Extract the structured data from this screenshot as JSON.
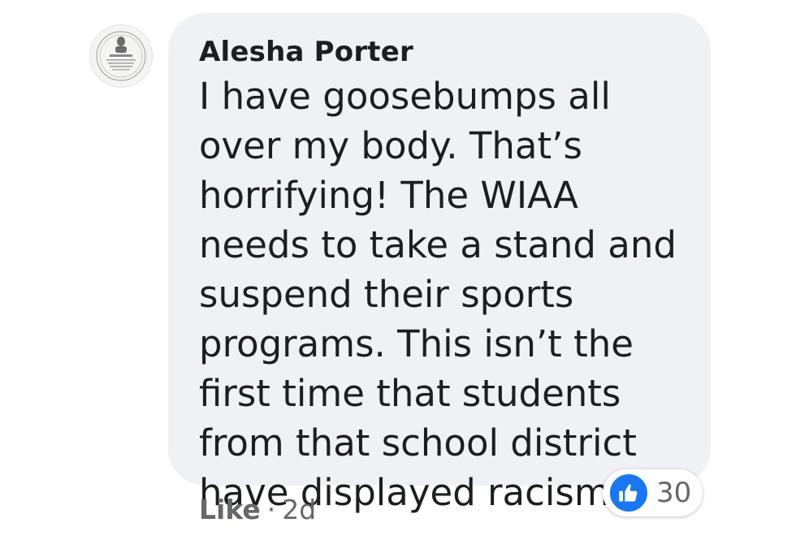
{
  "comment": {
    "author": "Alesha Porter",
    "text": "I have goosebumps all over my body. That’s horrifying! The WIAA needs to take a stand and suspend their sports programs. This isn’t the first time that students from that school district have displayed racism.",
    "reaction_icon": "thumbs-up-icon",
    "reaction_count": "30",
    "like_label": "Like",
    "separator": "·",
    "timestamp": "2d",
    "avatar_icon": "profile-photo-seal",
    "colors": {
      "bubble": "#eff1f4",
      "like_blue": "#1877f2",
      "secondary_text": "#65676b"
    }
  }
}
